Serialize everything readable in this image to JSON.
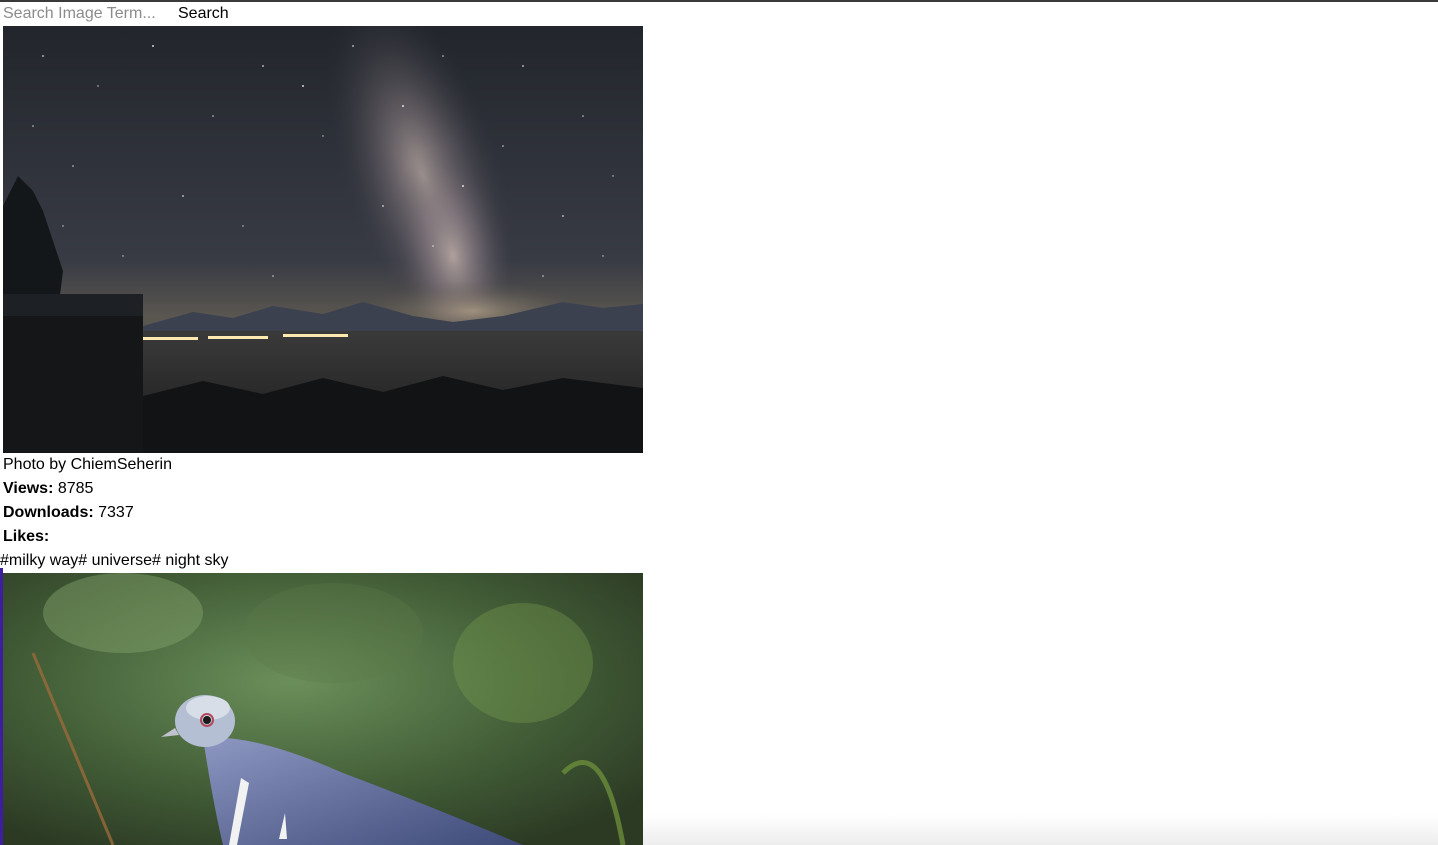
{
  "search": {
    "placeholder": "Search Image Term...",
    "value": "",
    "button_label": "Search"
  },
  "images": [
    {
      "photo_by": "Photo by ChiemSeherin",
      "views_label": "Views:",
      "views": "8785",
      "downloads_label": "Downloads:",
      "downloads": "7337",
      "likes_label": "Likes:",
      "likes": "",
      "tags": "#milky way# universe# night sky"
    },
    {
      "photo_by": "",
      "views_label": "",
      "views": "",
      "downloads_label": "",
      "downloads": "",
      "likes_label": "",
      "likes": "",
      "tags": ""
    }
  ],
  "colors": {
    "focus_outline": "#3d1e9e",
    "placeholder_text": "#8b8b8b"
  }
}
